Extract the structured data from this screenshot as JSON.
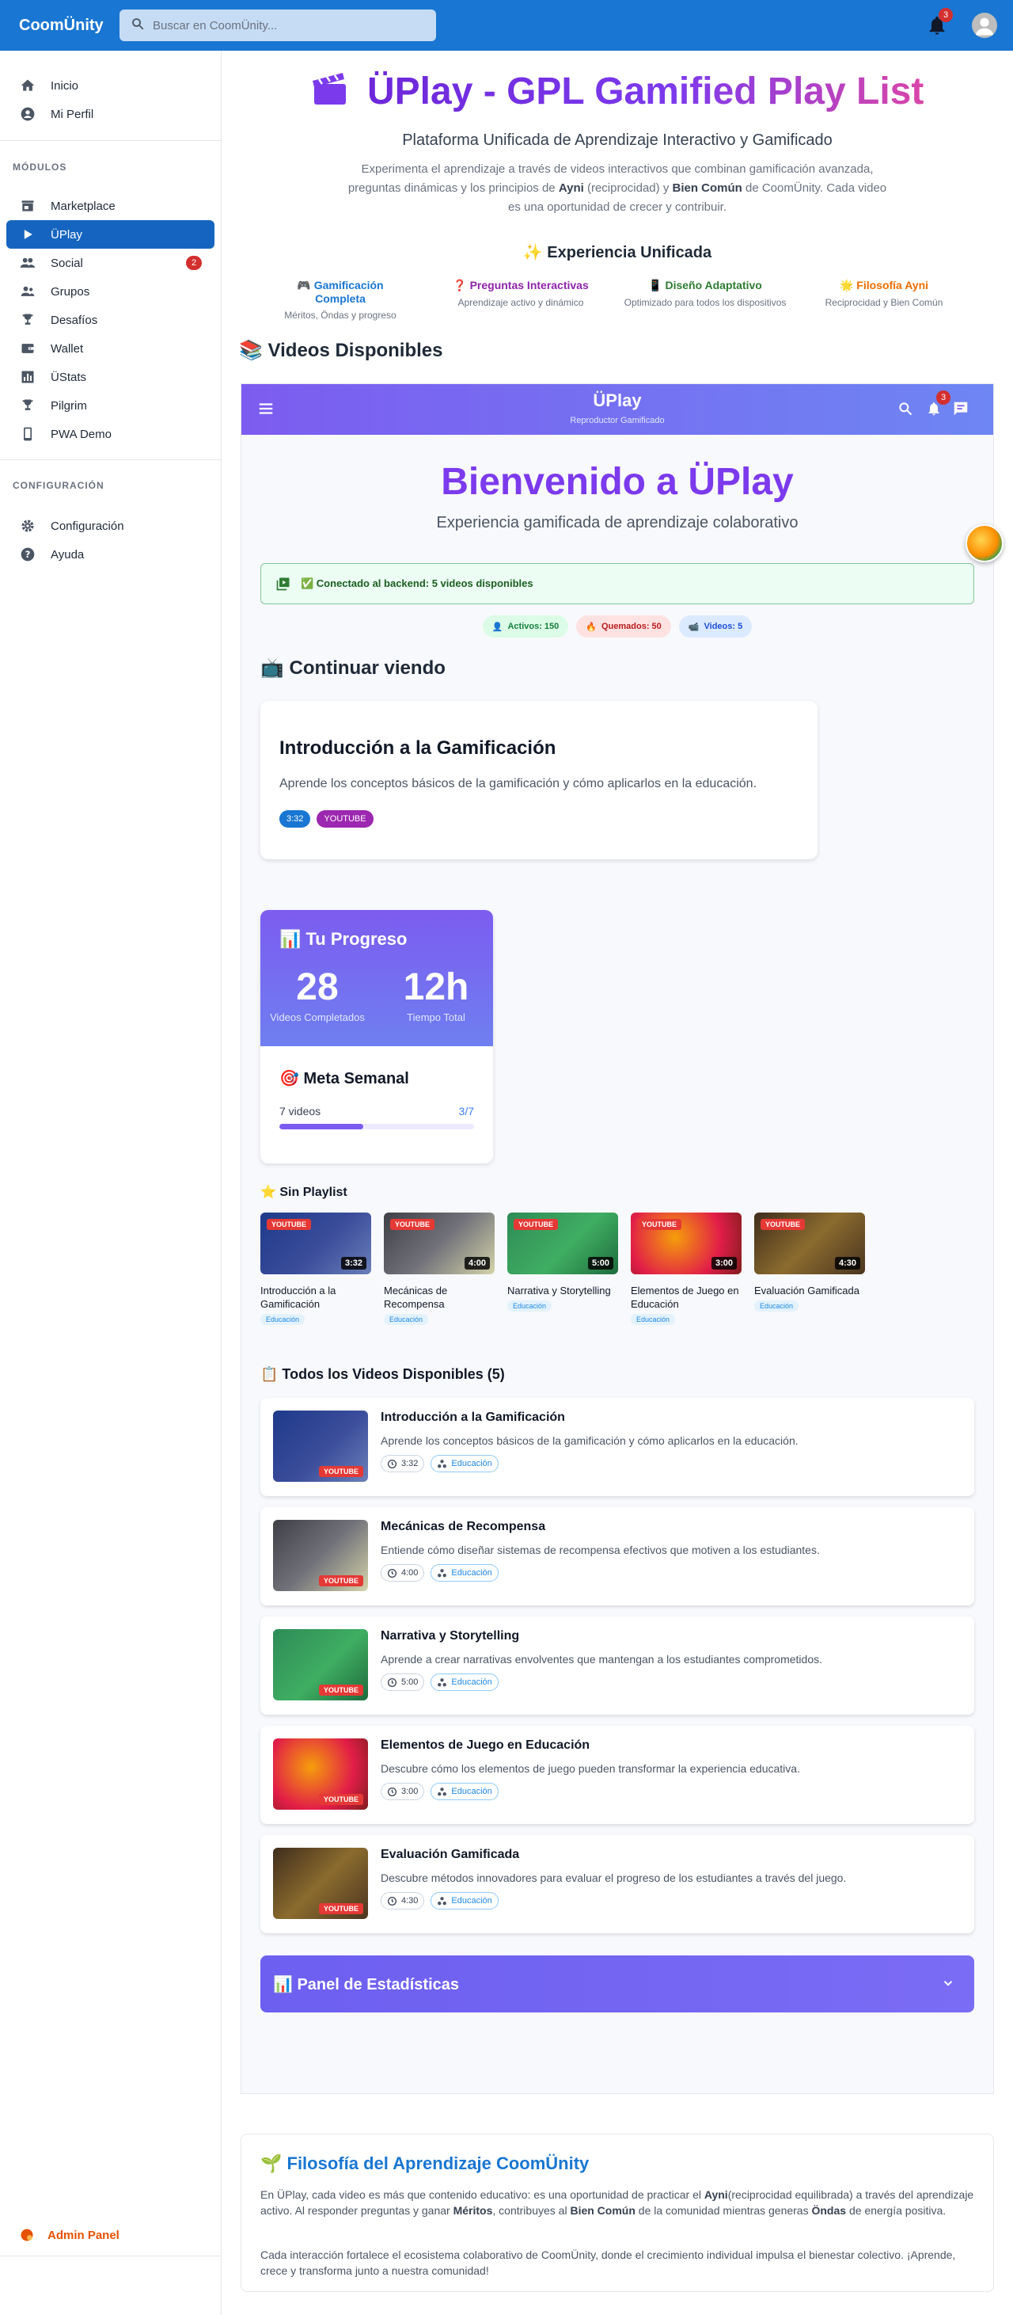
{
  "app": {
    "brand": "CoomÜnity"
  },
  "search": {
    "placeholder": "Buscar en CoomÜnity..."
  },
  "topbar": {
    "notifications": "3"
  },
  "sidebar": {
    "top_items": [
      {
        "label": "Inicio",
        "icon": "home-icon"
      },
      {
        "label": "Mi Perfil",
        "icon": "account-icon"
      }
    ],
    "modules_header": "MÓDULOS",
    "modules": [
      {
        "label": "Marketplace",
        "icon": "store-icon"
      },
      {
        "label": "ÜPlay",
        "icon": "play-icon",
        "active": true
      },
      {
        "label": "Social",
        "icon": "people-icon",
        "badge": "2"
      },
      {
        "label": "Grupos",
        "icon": "groups-icon"
      },
      {
        "label": "Desafíos",
        "icon": "trophy-icon"
      },
      {
        "label": "Wallet",
        "icon": "wallet-icon"
      },
      {
        "label": "ÜStats",
        "icon": "stats-icon"
      },
      {
        "label": "Pilgrim",
        "icon": "trophy-icon"
      },
      {
        "label": "PWA Demo",
        "icon": "phone-icon"
      }
    ],
    "config_header": "CONFIGURACIÓN",
    "config": [
      {
        "label": "Configuración",
        "icon": "gear-icon"
      },
      {
        "label": "Ayuda",
        "icon": "help-icon"
      }
    ],
    "admin": "Admin Panel"
  },
  "hero": {
    "title": "ÜPlay - GPL Gamified Play List",
    "subtitle": "Plataforma Unificada de Aprendizaje Interactivo y Gamificado",
    "desc_1": "Experimenta el aprendizaje a través de videos interactivos que combinan gamificación avanzada, preguntas dinámicas y los principios de ",
    "desc_ayni": "Ayni",
    "desc_2": " (reciprocidad) y ",
    "desc_bien": "Bien Común",
    "desc_3": " de CoomÜnity. Cada video es una oportunidad de crecer y contribuir.",
    "experience_title": "✨ Experiencia Unificada",
    "features": [
      {
        "title": "🎮 Gamificación Completa",
        "desc": "Méritos, Öndas y progreso",
        "color": "#1976d2"
      },
      {
        "title": "❓ Preguntas Interactivas",
        "desc": "Aprendizaje activo y dinámico",
        "color": "#8e24aa"
      },
      {
        "title": "📱 Diseño Adaptativo",
        "desc": "Optimizado para todos los dispositivos",
        "color": "#2e7d32"
      },
      {
        "title": "🌟 Filosofía Ayni",
        "desc": "Reciprocidad y Bien Común",
        "color": "#ef6c00"
      }
    ]
  },
  "videos_section": {
    "title": "📚 Videos Disponibles"
  },
  "player": {
    "title": "ÜPlay",
    "subtitle": "Reproductor Gamificado",
    "notifications": "3",
    "welcome": "Bienvenido a ÜPlay",
    "welcome_sub": "Experiencia gamificada de aprendizaje colaborativo",
    "connection": "✅ Conectado al backend: 5 videos disponibles",
    "chips": [
      {
        "label": "Activos: 150",
        "bg": "#dcfce7",
        "fg": "#15803d",
        "icon": "person-icon"
      },
      {
        "label": "Quemados: 50",
        "bg": "#fee2e2",
        "fg": "#b91c1c",
        "icon": "fire-icon"
      },
      {
        "label": "Videos: 5",
        "bg": "#dbeafe",
        "fg": "#1d4ed8",
        "icon": "video-icon"
      }
    ],
    "continue": {
      "title": "📺 Continuar viendo",
      "card_title": "Introducción a la Gamificación",
      "card_desc": "Aprende los conceptos básicos de la gamificación y cómo aplicarlos en la educación.",
      "duration": "3:32",
      "platform": "YOUTUBE"
    },
    "progress": {
      "title": "📊 Tu Progreso",
      "completed_value": "28",
      "completed_label": "Videos Completados",
      "time_value": "12h",
      "time_label": "Tiempo Total",
      "goal_title": "🎯 Meta Semanal",
      "goal_label": "7 videos",
      "goal_status": "3/7",
      "goal_fraction": 0.43
    },
    "playlist": {
      "title": "⭐ Sin Playlist",
      "badge": "YOUTUBE",
      "items": [
        {
          "title": "Introducción a la Gamificación",
          "duration": "3:32",
          "category": "Educación",
          "bg": "linear-gradient(135deg,#1e3a8a,#3b4d9b 55%,#6b7fb8)"
        },
        {
          "title": "Mecánicas de Recompensa",
          "duration": "4:00",
          "category": "Educación",
          "bg": "linear-gradient(135deg,#3f3f46,#71717a 50%,#d4d4aa)"
        },
        {
          "title": "Narrativa y Storytelling",
          "duration": "5:00",
          "category": "Educación",
          "bg": "linear-gradient(135deg,#2e8b57,#3fae62 55%,#1f6b3d)"
        },
        {
          "title": "Elementos de Juego en Educación",
          "duration": "3:00",
          "category": "Educación",
          "bg": "radial-gradient(circle at 40% 40%,#f59e0b,#e11d48 60%,#7f1d1d)"
        },
        {
          "title": "Evaluación Gamificada",
          "duration": "4:30",
          "category": "Educación",
          "bg": "linear-gradient(135deg,#3f2d1c,#8b6b2e 50%,#4a3520)"
        }
      ]
    },
    "all_videos": {
      "title": "📋 Todos los Videos Disponibles (5)",
      "badge": "YOUTUBE",
      "items": [
        {
          "title": "Introducción a la Gamificación",
          "desc": "Aprende los conceptos básicos de la gamificación y cómo aplicarlos en la educación.",
          "duration": "3:32",
          "category": "Educación"
        },
        {
          "title": "Mecánicas de Recompensa",
          "desc": "Entiende cómo diseñar sistemas de recompensa efectivos que motiven a los estudiantes.",
          "duration": "4:00",
          "category": "Educación"
        },
        {
          "title": "Narrativa y Storytelling",
          "desc": "Aprende a crear narrativas envolventes que mantengan a los estudiantes comprometidos.",
          "duration": "5:00",
          "category": "Educación"
        },
        {
          "title": "Elementos de Juego en Educación",
          "desc": "Descubre cómo los elementos de juego pueden transformar la experiencia educativa.",
          "duration": "3:00",
          "category": "Educación"
        },
        {
          "title": "Evaluación Gamificada",
          "desc": "Descubre métodos innovadores para evaluar el progreso de los estudiantes a través del juego.",
          "duration": "4:30",
          "category": "Educación"
        }
      ]
    },
    "stats_panel": "📊 Panel de Estadísticas"
  },
  "philosophy": {
    "title": "🌱 Filosofía del Aprendizaje CoomÜnity",
    "p1_a": "En ÜPlay, cada video es más que contenido educativo: es una oportunidad de practicar el ",
    "p1_ayni": "Ayni",
    "p1_b": "(reciprocidad equilibrada) a través del aprendizaje activo. Al responder preguntas y ganar ",
    "p1_meritos": "Méritos",
    "p1_c": ", contribuyes al ",
    "p1_bien": "Bien Común",
    "p1_d": " de la comunidad mientras generas ",
    "p1_ondas": "Öndas",
    "p1_e": " de energía positiva.",
    "p2": "Cada interacción fortalece el ecosistema colaborativo de CoomÜnity, donde el crecimiento individual impulsa el bienestar colectivo. ¡Aprende, crece y transforma junto a nuestra comunidad!"
  }
}
